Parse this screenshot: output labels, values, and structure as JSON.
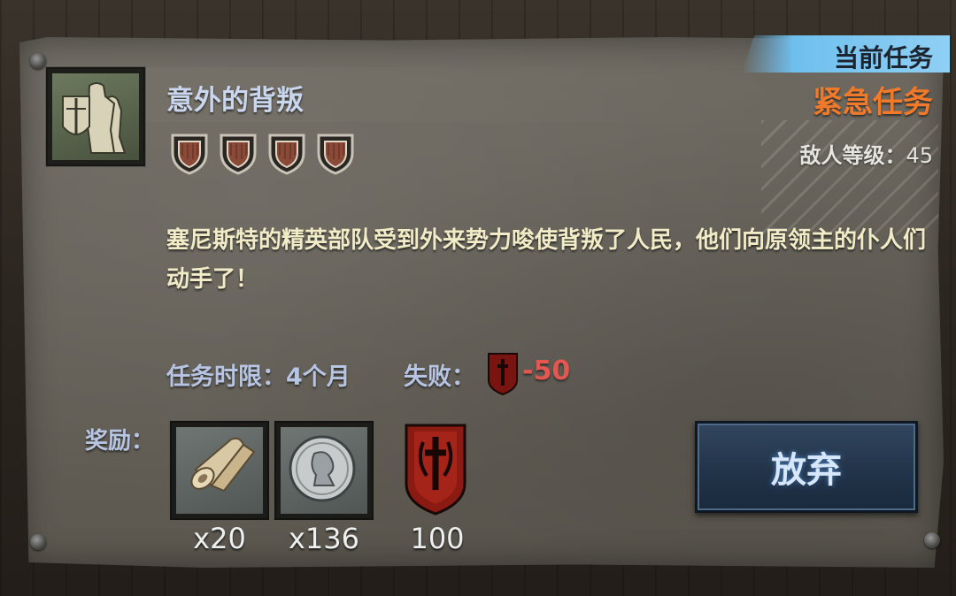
{
  "quest": {
    "title": "意外的背叛",
    "tag_current": "当前任务",
    "urgency": "紧急任务",
    "enemy_level_label": "敌人等级：",
    "enemy_level_value": "45",
    "difficulty_shields": 4,
    "description": "塞尼斯特的精英部队受到外来势力唆使背叛了人民，他们向原领主的仆人们动手了！",
    "time_limit_label": "任务时限：",
    "time_limit_value": "4个月",
    "fail_label": "失败：",
    "fail_value": "-50",
    "rewards_label": "奖励：",
    "rewards": [
      {
        "icon": "scroll-icon",
        "count": "x20"
      },
      {
        "icon": "silver-coin-icon",
        "count": "x136"
      },
      {
        "icon": "faction-banner-icon",
        "count": "100"
      }
    ],
    "abandon_button": "放弃"
  },
  "colors": {
    "title": "#c9d6ee",
    "urgent": "#f07a2a",
    "description": "#f1ecc7",
    "label": "#b7c5e3",
    "fail_value": "#e2574f",
    "tag_bg": "#8fd0f5",
    "button_bg": "#22344a"
  }
}
